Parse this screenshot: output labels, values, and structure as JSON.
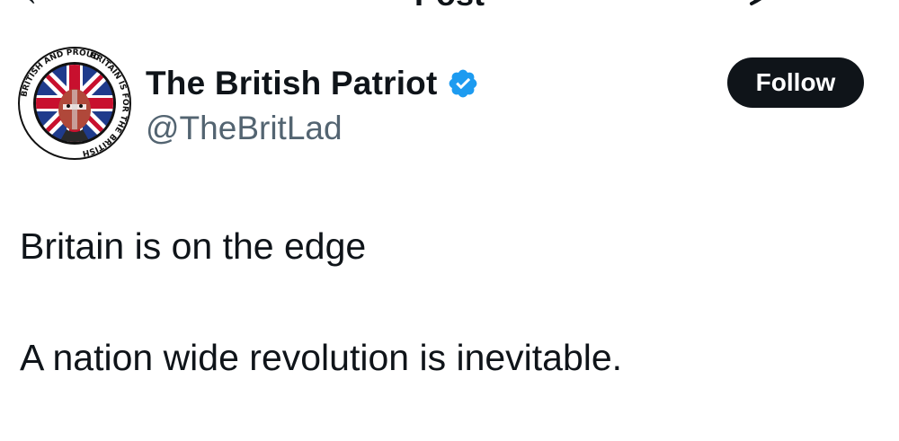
{
  "topbar": {
    "title": "Post",
    "back_icon": "arrow-left-icon",
    "action_icon": "grok-icon"
  },
  "author": {
    "display_name": "The British Patriot",
    "handle": "@TheBritLad",
    "verified_icon": "verified-badge-icon",
    "verified_color": "#1d9bf0",
    "avatar_ring_text_top": "BRITISH AND PROUD",
    "avatar_ring_text_right": "BRITAIN IS FOR THE BRITISH"
  },
  "follow_button": {
    "label": "Follow"
  },
  "tweet": {
    "lines": [
      "Britain is on the edge",
      "A nation wide revolution is inevitable."
    ]
  },
  "colors": {
    "text_primary": "#0f1419",
    "text_secondary": "#536471",
    "button_bg": "#0f1419",
    "button_text": "#ffffff",
    "accent": "#1d9bf0"
  }
}
